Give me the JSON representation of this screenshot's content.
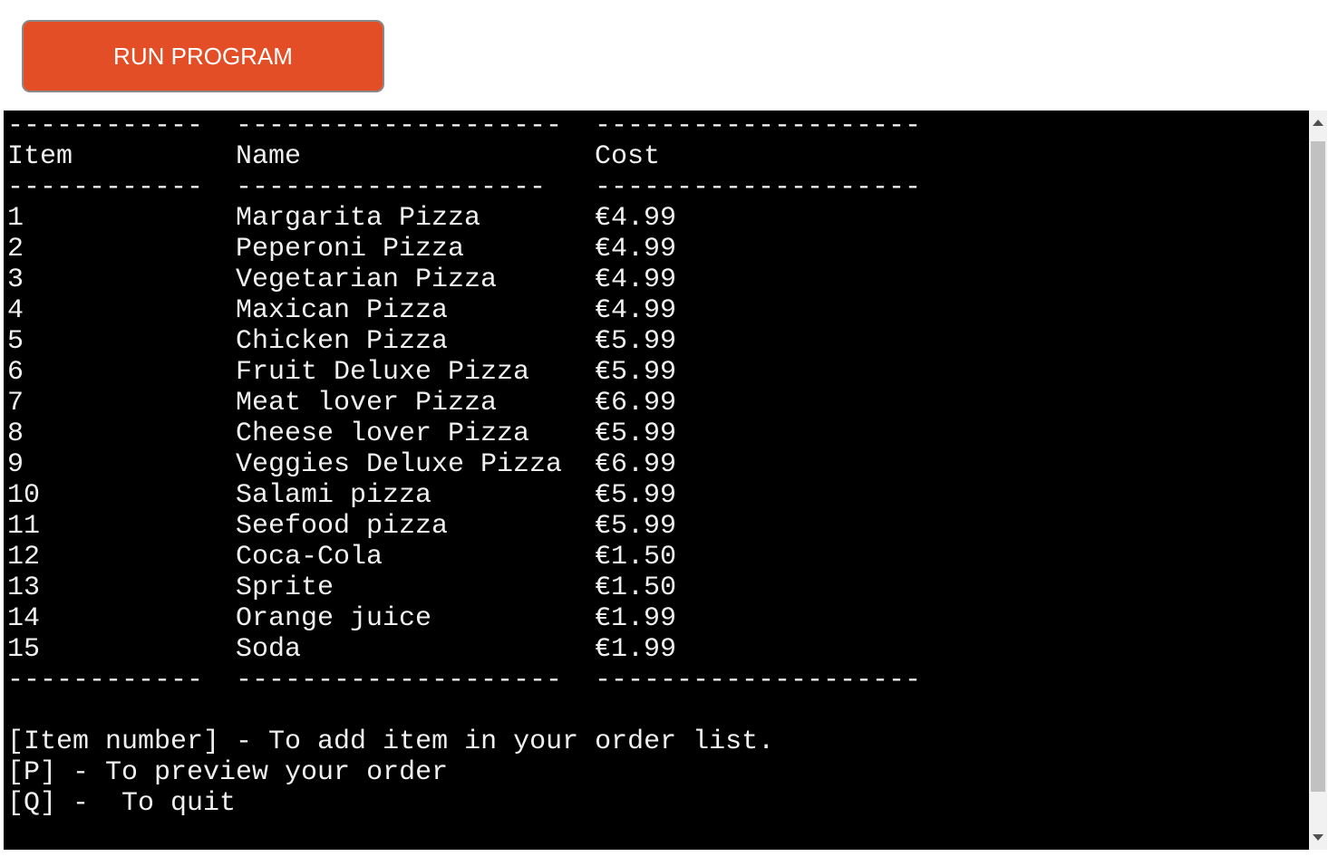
{
  "toolbar": {
    "run_label": "RUN PROGRAM",
    "run_color": "#e44e26"
  },
  "terminal": {
    "divider_top": [
      "------------",
      "--------------------",
      "--------------------"
    ],
    "header": {
      "item": "Item",
      "name": "Name",
      "cost": "Cost"
    },
    "divider_header": [
      "------------",
      "-------------------",
      "--------------------"
    ],
    "rows": [
      {
        "item": "1",
        "name": "Margarita Pizza",
        "cost": "€4.99"
      },
      {
        "item": "2",
        "name": "Peperoni Pizza",
        "cost": "€4.99"
      },
      {
        "item": "3",
        "name": "Vegetarian Pizza",
        "cost": "€4.99"
      },
      {
        "item": "4",
        "name": "Maxican Pizza",
        "cost": "€4.99"
      },
      {
        "item": "5",
        "name": "Chicken Pizza",
        "cost": "€5.99"
      },
      {
        "item": "6",
        "name": "Fruit Deluxe Pizza",
        "cost": "€5.99"
      },
      {
        "item": "7",
        "name": "Meat lover Pizza",
        "cost": "€6.99"
      },
      {
        "item": "8",
        "name": "Cheese lover Pizza",
        "cost": "€5.99"
      },
      {
        "item": "9",
        "name": "Veggies Deluxe Pizza",
        "cost": "€6.99"
      },
      {
        "item": "10",
        "name": "Salami pizza",
        "cost": "€5.99"
      },
      {
        "item": "11",
        "name": "Seefood pizza",
        "cost": "€5.99"
      },
      {
        "item": "12",
        "name": "Coca-Cola",
        "cost": "€1.50"
      },
      {
        "item": "13",
        "name": "Sprite",
        "cost": "€1.50"
      },
      {
        "item": "14",
        "name": "Orange juice",
        "cost": "€1.99"
      },
      {
        "item": "15",
        "name": "Soda",
        "cost": "€1.99"
      }
    ],
    "divider_bottom": [
      "------------",
      "--------------------",
      "--------------------"
    ],
    "instructions": [
      "[Item number] - To add item in your order list.",
      "[P] - To preview your order",
      "[Q] -  To quit"
    ],
    "background": "#000000",
    "text_color": "#f0f0f0"
  }
}
